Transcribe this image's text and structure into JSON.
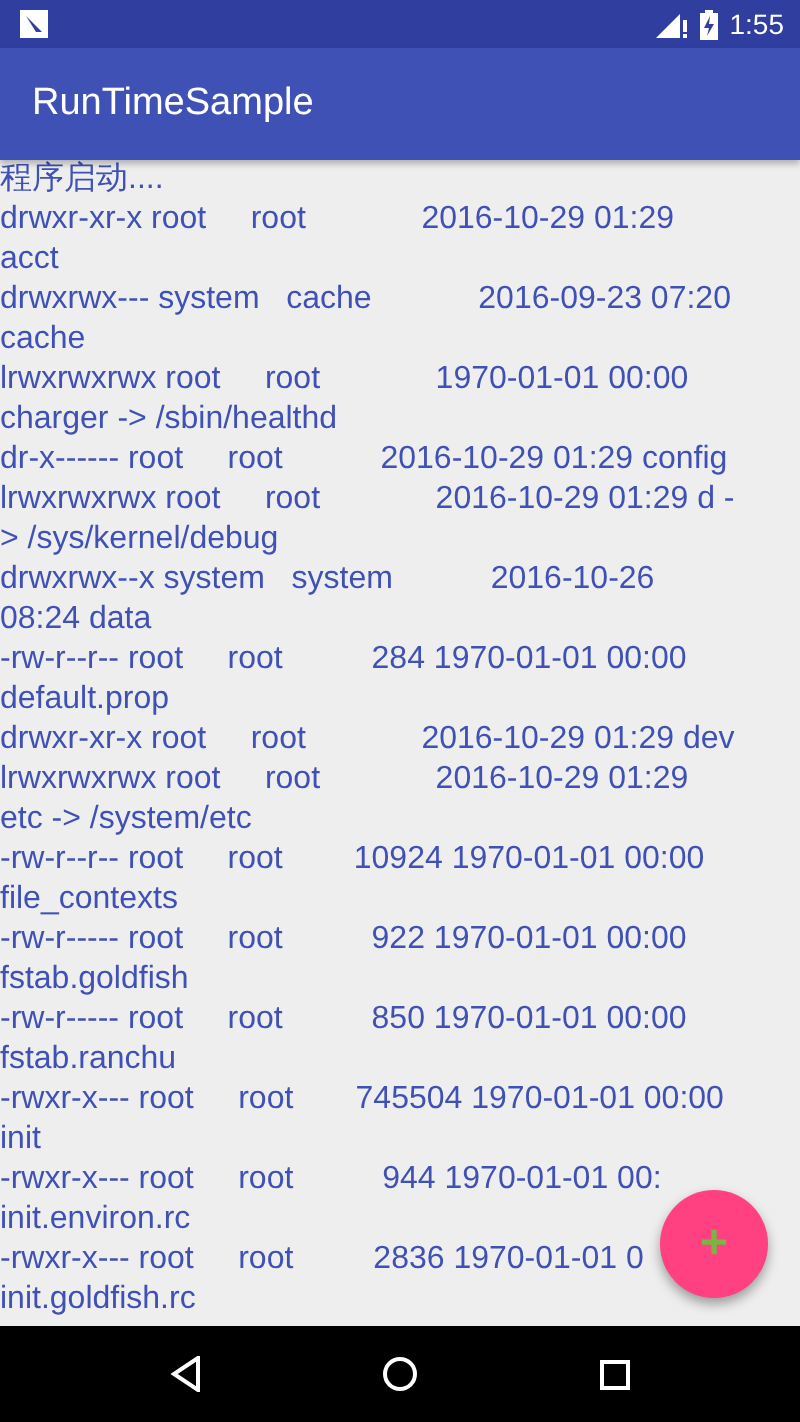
{
  "status_bar": {
    "time": "1:55"
  },
  "app_bar": {
    "title": "RunTimeSample"
  },
  "log_lines": [
    "程序启动....",
    "drwxr-xr-x root     root             2016-10-29 01:29",
    "acct",
    "drwxrwx--- system   cache            2016-09-23 07:20",
    "cache",
    "lrwxrwxrwx root     root             1970-01-01 00:00",
    "charger -> /sbin/healthd",
    "dr-x------ root     root           2016-10-29 01:29 config",
    "lrwxrwxrwx root     root             2016-10-29 01:29 d -",
    "> /sys/kernel/debug",
    "drwxrwx--x system   system           2016-10-26",
    "08:24 data",
    "-rw-r--r-- root     root          284 1970-01-01 00:00",
    "default.prop",
    "drwxr-xr-x root     root             2016-10-29 01:29 dev",
    "lrwxrwxrwx root     root             2016-10-29 01:29",
    "etc -> /system/etc",
    "-rw-r--r-- root     root        10924 1970-01-01 00:00",
    "file_contexts",
    "-rw-r----- root     root          922 1970-01-01 00:00",
    "fstab.goldfish",
    "-rw-r----- root     root          850 1970-01-01 00:00",
    "fstab.ranchu",
    "-rwxr-x--- root     root       745504 1970-01-01 00:00",
    "init",
    "-rwxr-x--- root     root          944 1970-01-01 00:",
    "init.environ.rc",
    "-rwxr-x--- root     root         2836 1970-01-01 0",
    "init.goldfish.rc"
  ],
  "fab": {
    "label": "+"
  }
}
